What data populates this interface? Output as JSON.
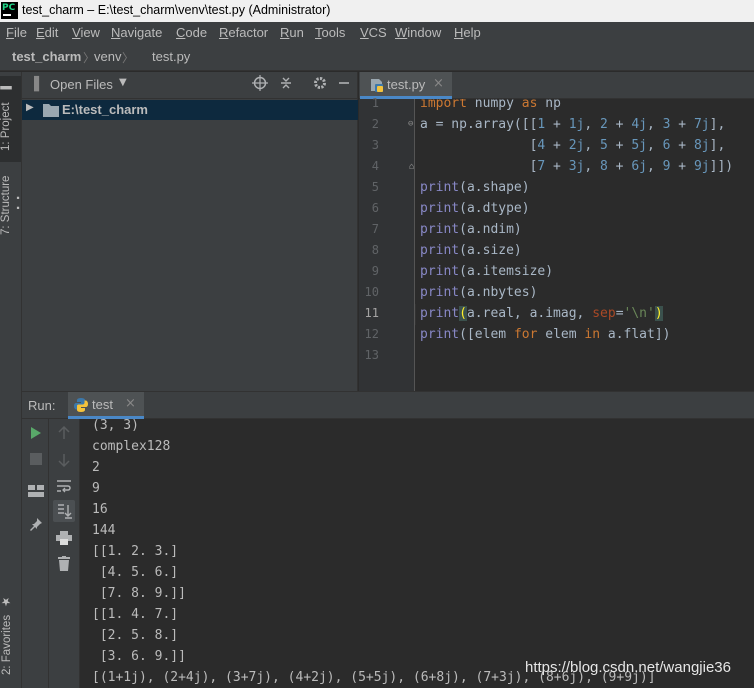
{
  "window": {
    "title": "test_charm – E:\\test_charm\\venv\\test.py (Administrator)"
  },
  "menu": [
    {
      "mnemonic": "F",
      "rest": "ile"
    },
    {
      "mnemonic": "E",
      "rest": "dit"
    },
    {
      "mnemonic": "V",
      "rest": "iew"
    },
    {
      "mnemonic": "N",
      "rest": "avigate"
    },
    {
      "mnemonic": "C",
      "rest": "ode"
    },
    {
      "mnemonic": "R",
      "rest": "efactor"
    },
    {
      "mnemonic": "R",
      "rest": "un"
    },
    {
      "mnemonic": "T",
      "rest": "ools"
    },
    {
      "mnemonic": "V",
      "rest": "CS"
    },
    {
      "mnemonic": "W",
      "rest": "indow"
    },
    {
      "mnemonic": "H",
      "rest": "elp"
    }
  ],
  "breadcrumb": {
    "project": "test_charm",
    "folder": "venv",
    "file": "test.py"
  },
  "left_strip": {
    "project_tab": "1: Project",
    "structure_tab": "7: Structure",
    "favorites_tab": "2: Favorites"
  },
  "project_panel": {
    "view_selector": "Open Files",
    "root_item": "E:\\test_charm"
  },
  "editor": {
    "tab_label": "test.py",
    "current_line": 11,
    "lines": [
      1,
      2,
      3,
      4,
      5,
      6,
      7,
      8,
      9,
      10,
      11,
      12,
      13
    ]
  },
  "run_panel": {
    "label": "Run:",
    "tab_label": "test",
    "output": [
      "(3, 3)",
      "complex128",
      "2",
      "9",
      "16",
      "144",
      "[[1. 2. 3.]",
      " [4. 5. 6.]",
      " [7. 8. 9.]]",
      "[[1. 4. 7.]",
      " [2. 5. 8.]",
      " [3. 6. 9.]]",
      "[(1+1j), (2+4j), (3+7j), (4+2j), (5+5j), (6+8j), (7+3j), (8+6j), (9+9j)]"
    ]
  },
  "watermark": "https://blog.csdn.net/wangjie36",
  "colors": {
    "keyword": "#cc7832",
    "number": "#6897bb",
    "builtin": "#8888c6",
    "string": "#6a8759",
    "accent": "#4a88c7"
  }
}
